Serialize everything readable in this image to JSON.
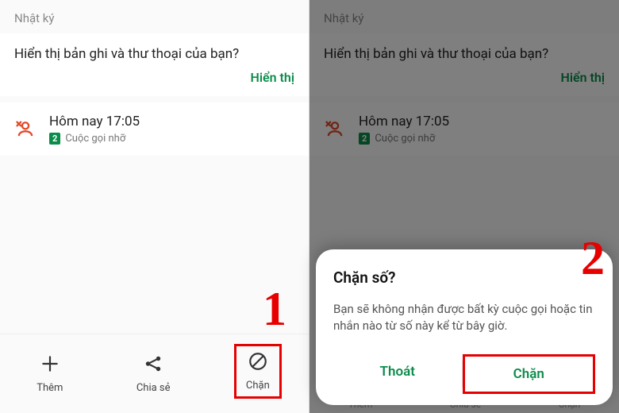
{
  "left": {
    "section_title": "Nhật ký",
    "prompt": "Hiển thị bản ghi và thư thoại của bạn?",
    "show_label": "Hiển thị",
    "call": {
      "time": "Hôm nay 17:05",
      "badge": "2",
      "missed_label": "Cuộc gọi nhỡ"
    },
    "actions": {
      "add": "Thêm",
      "share": "Chia sẻ",
      "block": "Chặn"
    },
    "annotation": "1"
  },
  "right": {
    "section_title": "Nhật ký",
    "prompt": "Hiển thị bản ghi và thư thoại của bạn?",
    "show_label": "Hiển thị",
    "call": {
      "time": "Hôm nay 17:05",
      "badge": "2",
      "missed_label": "Cuộc gọi nhỡ"
    },
    "dim_actions": {
      "add": "Thêm",
      "share": "Chia sẻ",
      "block": "Chặn"
    },
    "dialog": {
      "title": "Chặn số?",
      "body": "Bạn sẽ không nhận được bất kỳ cuộc gọi hoặc tin nhắn nào từ số này kể từ bây giờ.",
      "cancel": "Thoát",
      "confirm": "Chặn"
    },
    "annotation": "2"
  },
  "colors": {
    "accent": "#0b8c4a",
    "highlight": "#e60000",
    "missed": "#e24a2a"
  }
}
